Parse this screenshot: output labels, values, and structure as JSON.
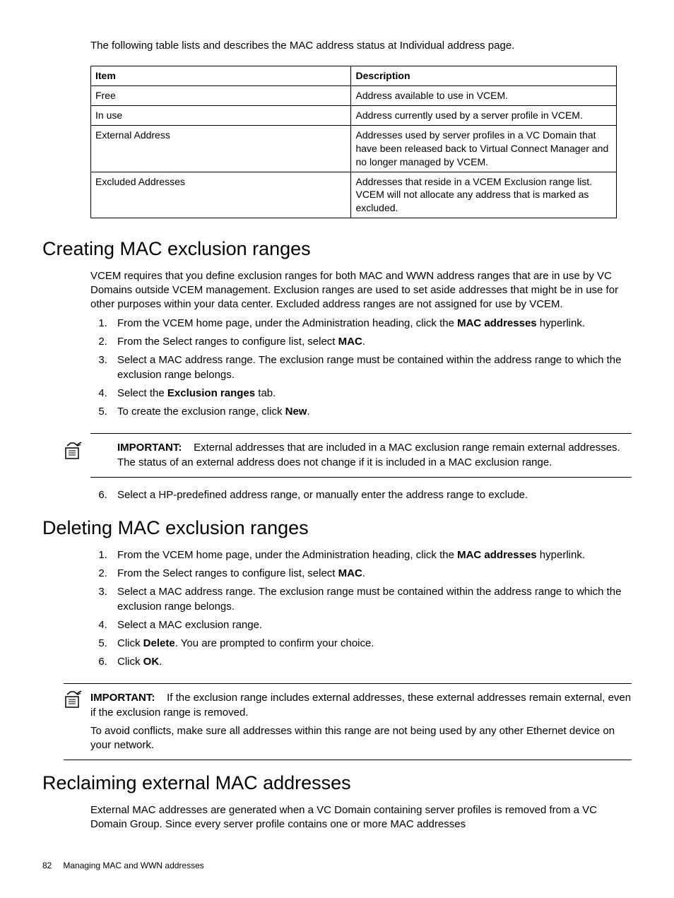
{
  "intro": "The following table lists and describes the MAC address status at Individual address page.",
  "table": {
    "header_item": "Item",
    "header_desc": "Description",
    "rows": [
      {
        "item": "Free",
        "desc": "Address available to use in VCEM."
      },
      {
        "item": "In use",
        "desc": "Address currently used by a server profile in VCEM."
      },
      {
        "item": "External Address",
        "desc": "Addresses used by server profiles in a VC Domain that have been released back to Virtual Connect Manager and no longer managed by VCEM."
      },
      {
        "item": "Excluded Addresses",
        "desc": "Addresses that reside in a VCEM Exclusion range list. VCEM will not allocate any address that is marked as excluded."
      }
    ]
  },
  "section1": {
    "title": "Creating MAC exclusion ranges",
    "para": "VCEM requires that you define exclusion ranges for both MAC and WWN address ranges that are in use by VC Domains outside VCEM management. Exclusion ranges are used to set aside addresses that might be in use for other purposes within your data center. Excluded address ranges are not assigned for use by VCEM.",
    "step1_a": "From the VCEM home page, under the Administration heading, click the ",
    "step1_b": "MAC addresses",
    "step1_c": " hyperlink.",
    "step2_a": "From the Select ranges to configure list, select ",
    "step2_b": "MAC",
    "step2_c": ".",
    "step3": "Select a MAC address range. The exclusion range must be contained within the address range to which the exclusion range belongs.",
    "step4_a": "Select the ",
    "step4_b": "Exclusion ranges",
    "step4_c": " tab.",
    "step5_a": "To create the exclusion range, click ",
    "step5_b": "New",
    "step5_c": ".",
    "note_label": "IMPORTANT:",
    "note_text": "External addresses that are included in a MAC exclusion range remain external addresses. The status of an external address does not change if it is included in a MAC exclusion range.",
    "step6": "Select a HP-predefined address range, or manually enter the address range to exclude."
  },
  "section2": {
    "title": "Deleting MAC exclusion ranges",
    "step1_a": "From the VCEM home page, under the Administration heading, click the ",
    "step1_b": "MAC addresses",
    "step1_c": " hyperlink.",
    "step2_a": "From the Select ranges to configure list, select ",
    "step2_b": "MAC",
    "step2_c": ".",
    "step3": "Select a MAC address range. The exclusion range must be contained within the address range to which the exclusion range belongs.",
    "step4": "Select a MAC exclusion range.",
    "step5_a": "Click ",
    "step5_b": "Delete",
    "step5_c": ". You are prompted to confirm your choice.",
    "step6_a": "Click ",
    "step6_b": "OK",
    "step6_c": ".",
    "note_label": "IMPORTANT:",
    "note_text1": "If the exclusion range includes external addresses, these external addresses remain external, even if the exclusion range is removed.",
    "note_text2": "To avoid conflicts, make sure all addresses within this range are not being used by any other Ethernet device on your network."
  },
  "section3": {
    "title": "Reclaiming external MAC addresses",
    "para": "External MAC addresses are generated when a VC Domain containing server profiles is removed from a VC Domain Group. Since every server profile contains one or more MAC addresses"
  },
  "footer": {
    "page": "82",
    "chapter": "Managing MAC and WWN addresses"
  }
}
